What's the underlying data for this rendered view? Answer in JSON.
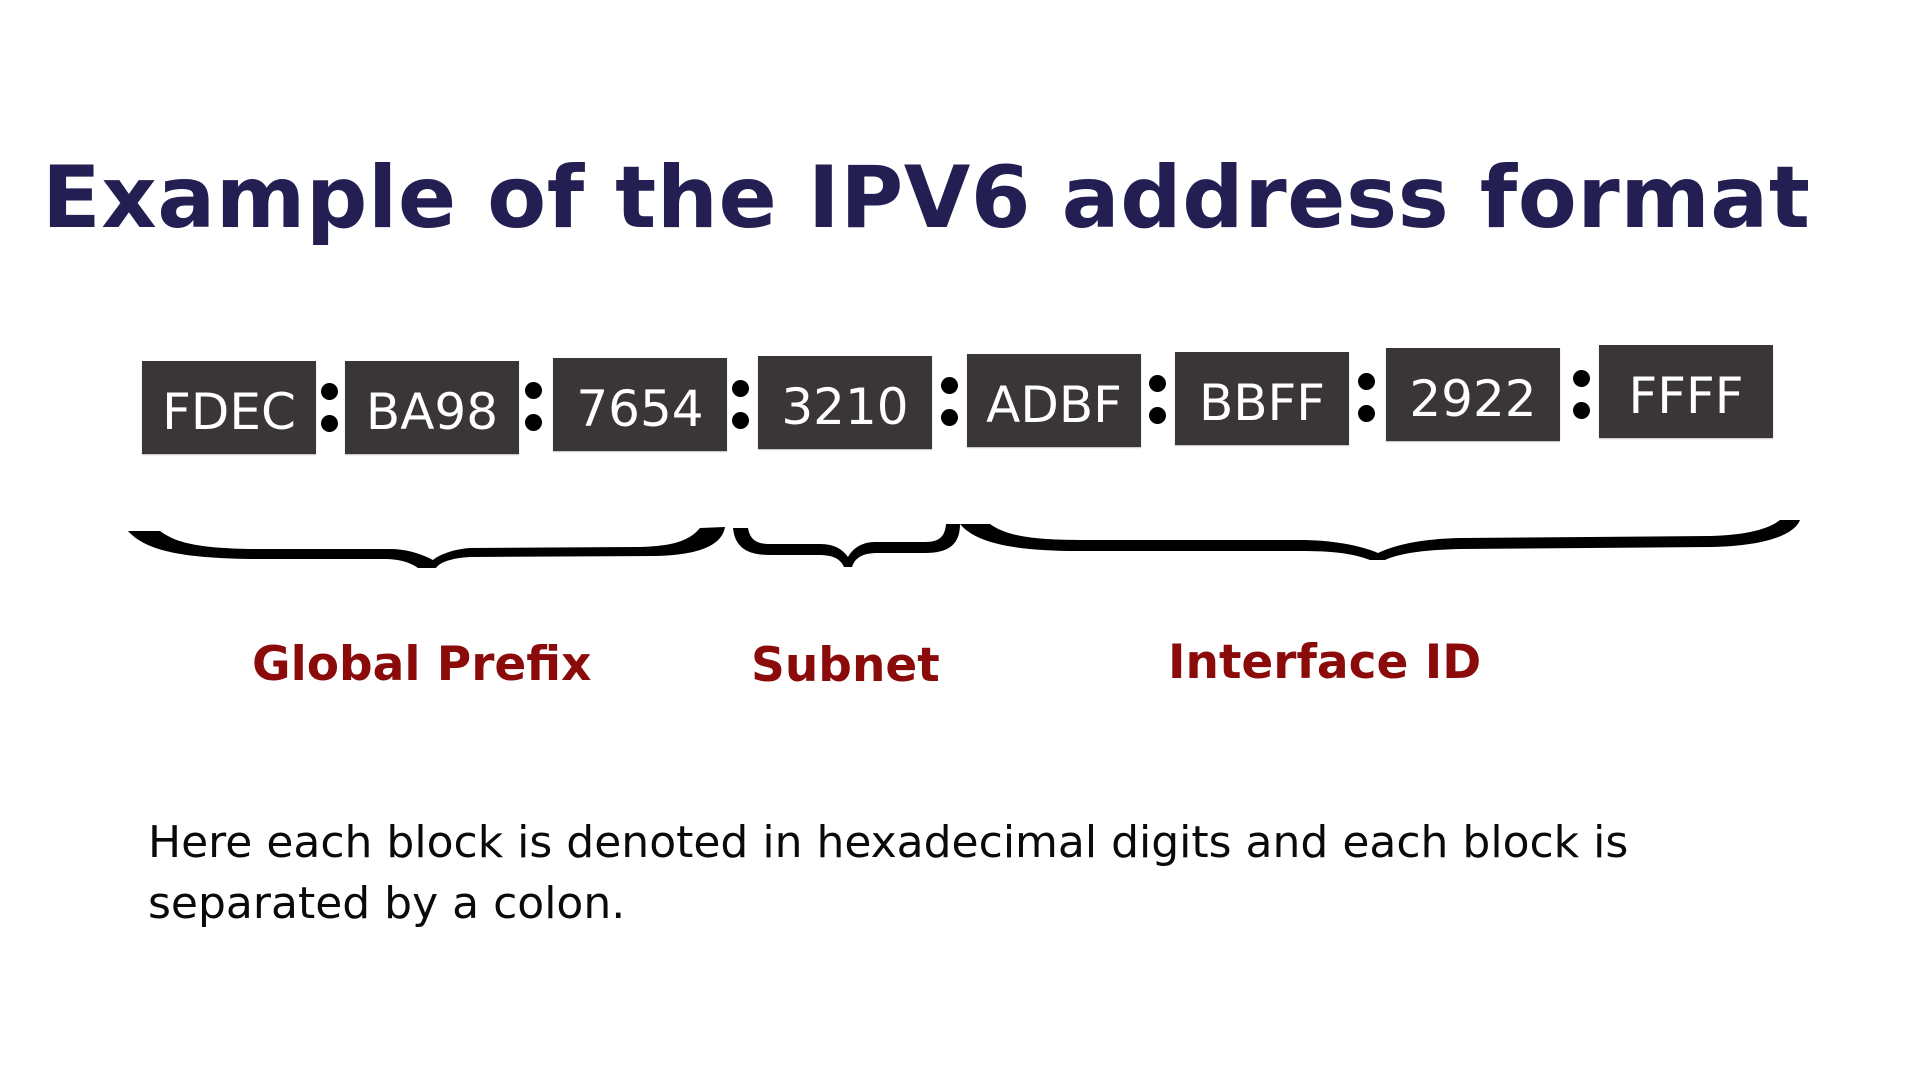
{
  "title": "Example of the IPV6 address format",
  "address": {
    "separator": ":",
    "blocks": [
      "FDEC",
      "BA98",
      "7654",
      "3210",
      "ADBF",
      "BBFF",
      "2922",
      "FFFF"
    ],
    "block_color": "#3a3536",
    "text_color": "#ffffff"
  },
  "groups": [
    {
      "label": "Global Prefix",
      "blocks": [
        "FDEC",
        "BA98",
        "7654"
      ]
    },
    {
      "label": "Subnet",
      "blocks": [
        "3210"
      ]
    },
    {
      "label": "Interface ID",
      "blocks": [
        "ADBF",
        "BBFF",
        "2922",
        "FFFF"
      ]
    }
  ],
  "colors": {
    "title": "#231f52",
    "group_label": "#8b0a0a",
    "brace": "#000000"
  },
  "description": "Here each block is denoted in hexadecimal digits and each block is separated by a colon."
}
